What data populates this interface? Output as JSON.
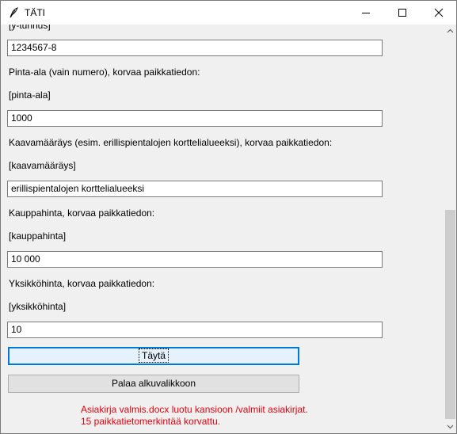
{
  "window": {
    "title": "TÄTI",
    "controls": [
      "minimize-icon",
      "maximize-icon",
      "close-icon"
    ]
  },
  "form": {
    "ytunnus_tag": "[y-tunnus]",
    "ytunnus_value": "1234567-8",
    "pinta_ala_label": "Pinta-ala (vain numero), korvaa paikkatiedon:",
    "pinta_ala_tag": "[pinta-ala]",
    "pinta_ala_value": "1000",
    "kaava_label": "Kaavamääräys (esim. erillispientalojen korttelialueeksi), korvaa paikkatiedon:",
    "kaava_tag": "[kaavamääräys]",
    "kaava_value": "erillispientalojen korttelialueeksi",
    "kauppahinta_label": "Kauppahinta, korvaa paikkatiedon:",
    "kauppahinta_tag": "[kauppahinta]",
    "kauppahinta_value": "10 000",
    "yksikkohinta_label": "Yksikköhinta, korvaa paikkatiedon:",
    "yksikkohinta_tag": "[yksikköhinta]",
    "yksikkohinta_value": "10"
  },
  "buttons": {
    "fill": "Täytä",
    "back": "Palaa alkuvalikkoon"
  },
  "status": {
    "line1": "Asiakirja valmis.docx luotu kansioon /valmiit asiakirjat.",
    "line2": "15 paikkatietomerkintää korvattu.",
    "color": "#e8000d"
  }
}
